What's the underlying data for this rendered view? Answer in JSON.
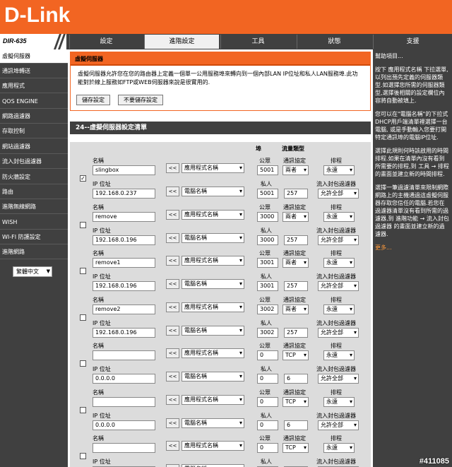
{
  "brand": {
    "logo": "D-Link",
    "model": "DIR-635"
  },
  "nav": {
    "tabs": [
      "設定",
      "進階設定",
      "工具",
      "狀態",
      "支援"
    ]
  },
  "sidebar": {
    "items": [
      "虛擬伺服器",
      "通訊埠轉送",
      "應用程式",
      "QOS ENGINE",
      "網路過濾器",
      "存取控制",
      "網站過濾器",
      "流入封包過濾器",
      "防火牆設定",
      "路由",
      "進階無線網路",
      "WISH",
      "WI-FI 防護設定",
      "進階網路"
    ],
    "language": "繁體中文"
  },
  "intro": {
    "title": "虛擬伺服器",
    "text": "虛擬伺服器允許您在您的路由器上定義一個單一公用服務埠來轉向到一個內部LAN IP位址和私人LAN服務埠.此功能對於線上服務如FTP或WEB伺服器來說是很實用的.",
    "save_button": "儲存設定",
    "nosave_button": "不要儲存設定"
  },
  "list": {
    "title": "24--虛擬伺服器設定清單",
    "headers": {
      "port": "埠",
      "traffic_type": "流量類型"
    },
    "labels": {
      "name": "名稱",
      "ip": "IP 位址",
      "public": "公眾",
      "private": "私人",
      "protocol": "通訊協定",
      "schedule": "排程",
      "inbound_filter": "流入封包過濾器",
      "app_name": "應用程式名稱",
      "computer_name": "電腦名稱",
      "arrow": "<<"
    },
    "rows": [
      {
        "checked": "✓",
        "name": "slingbox",
        "ip": "192.168.0.237",
        "public_port": "5001",
        "private_port": "5001",
        "protocol": "兩者",
        "proto_num": "257",
        "schedule": "永遠",
        "filter": "允許全部"
      },
      {
        "checked": "",
        "name": "remove",
        "ip": "192.168.0.196",
        "public_port": "3000",
        "private_port": "3000",
        "protocol": "兩者",
        "proto_num": "257",
        "schedule": "永遠",
        "filter": "允許全部"
      },
      {
        "checked": "",
        "name": "remove1",
        "ip": "192.168.0.196",
        "public_port": "3001",
        "private_port": "3001",
        "protocol": "兩者",
        "proto_num": "257",
        "schedule": "永遠",
        "filter": "允許全部"
      },
      {
        "checked": "",
        "name": "remove2",
        "ip": "192.168.0.196",
        "public_port": "3002",
        "private_port": "3002",
        "protocol": "兩者",
        "proto_num": "257",
        "schedule": "永遠",
        "filter": "允許全部"
      },
      {
        "checked": "",
        "name": "",
        "ip": "0.0.0.0",
        "public_port": "0",
        "private_port": "0",
        "protocol": "TCP",
        "proto_num": "6",
        "schedule": "永遠",
        "filter": "允許全部"
      },
      {
        "checked": "",
        "name": "",
        "ip": "0.0.0.0",
        "public_port": "0",
        "private_port": "0",
        "protocol": "TCP",
        "proto_num": "6",
        "schedule": "永遠",
        "filter": "允許全部"
      },
      {
        "checked": "",
        "name": "",
        "ip": "",
        "public_port": "0",
        "private_port": "",
        "protocol": "TCP",
        "proto_num": "",
        "schedule": "永遠",
        "filter": ""
      }
    ]
  },
  "help": {
    "title": "幫助項目...",
    "p1": "按下 應用程式名稱 下拉選單,以列出預先定義的伺服器類型.如選擇您所需的伺服器類型,選擇後相關的設定欄位內容將自動被填上.",
    "p2": "您可以在\"電腦名稱\"的下拉式DHCP用戶端清單裡選擇一台電腦, 或是手動輸入您要打開特定通訊埠的電腦IP位址.",
    "p3": "選擇此規則何時該啟用的時間排程.如果在清單內沒有看到所需要的排程,到 工具 → 排程 的畫面並建立新的時間排程.",
    "p4": "選擇一筆過濾清單來限制網際網路上的主機通過這虛擬伺服器存取您信任的電腦.若您在過濾器清單沒有看到所需的過濾器,到 進階功能 → 流入封包過濾器 的畫面並建立新的過濾器.",
    "more": "更多..."
  },
  "watermark": "#411085"
}
